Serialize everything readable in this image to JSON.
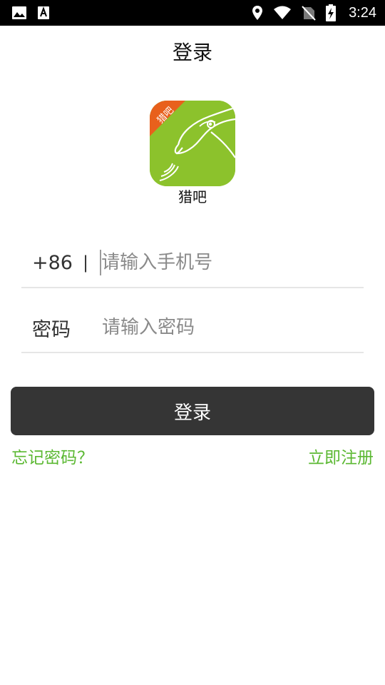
{
  "status_bar": {
    "time": "3:24",
    "icons": [
      "image-icon",
      "text-notification-icon",
      "location-icon",
      "wifi-icon",
      "no-sim-icon",
      "battery-charging-icon"
    ]
  },
  "page": {
    "title": "登录"
  },
  "app": {
    "name": "猎吧",
    "badge_text": "猎吧",
    "logo_color": "#8cc22c",
    "badge_color": "#e8601c"
  },
  "form": {
    "country_code": "+86",
    "separator": "|",
    "phone_placeholder": "请输入手机号",
    "password_label": "密码",
    "password_placeholder": "请输入密码"
  },
  "actions": {
    "login_label": "登录",
    "forgot_password": "忘记密码？",
    "register": "立即注册"
  },
  "colors": {
    "button": "#353535",
    "link": "#5bb832"
  }
}
